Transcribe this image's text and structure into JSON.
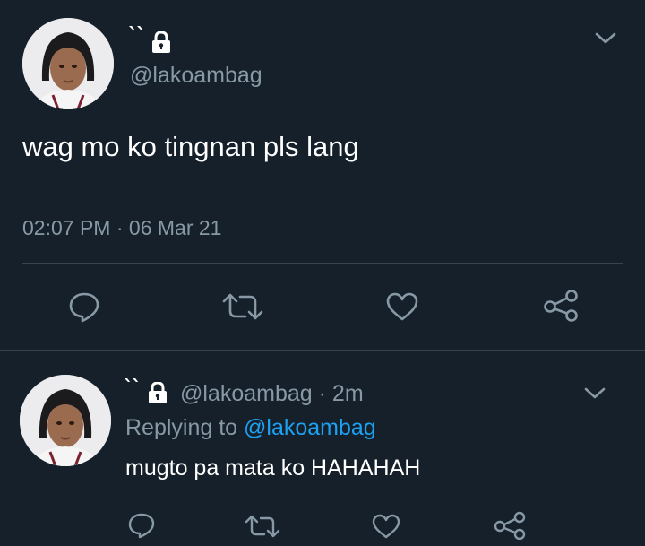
{
  "main_tweet": {
    "display_name": "``",
    "handle": "@lakoambag",
    "text": "wag mo ko tingnan pls lang",
    "time": "02:07 PM",
    "separator": "·",
    "date": "06 Mar 21",
    "protected": true,
    "actions": [
      "reply-icon",
      "retweet-icon",
      "like-icon",
      "share-icon"
    ]
  },
  "reply_tweet": {
    "display_name": "``",
    "handle": "@lakoambag",
    "age": "· 2m",
    "replying_prefix": "Replying to",
    "replying_to": "@lakoambag",
    "text": "mugto pa mata ko HAHAHAH",
    "protected": true,
    "actions": [
      "reply-icon",
      "retweet-icon",
      "like-icon",
      "share-icon"
    ]
  },
  "colors": {
    "background": "#15202b",
    "text": "#ffffff",
    "muted": "#8899a6",
    "link": "#1da1f2",
    "divider": "#38444d"
  }
}
